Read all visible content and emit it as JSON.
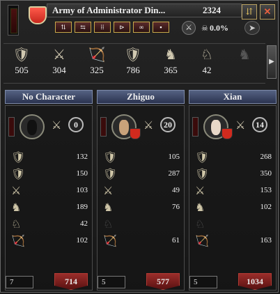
{
  "header": {
    "title": "Army of Administrator Din...",
    "count": "2324",
    "morale_pct": "0.0%",
    "accent": "#c7281e"
  },
  "totals": [
    {
      "icon": "archer-icon",
      "value": "505"
    },
    {
      "icon": "light-cavalry-icon",
      "value": "304"
    },
    {
      "icon": "pikemen-icon",
      "value": "325"
    },
    {
      "icon": "heavy-infantry-icon",
      "value": "786"
    },
    {
      "icon": "horse-archer-icon",
      "value": "365"
    },
    {
      "icon": "knight-icon",
      "value": "42"
    },
    {
      "icon": "camel-icon",
      "value": ""
    }
  ],
  "columns": [
    {
      "name": "No Character",
      "skill": "0",
      "flank_count": "7",
      "total": "714",
      "has_leader": false,
      "units": [
        "132",
        "150",
        "103",
        "189",
        "42",
        "102"
      ]
    },
    {
      "name": "Zhiguo",
      "skill": "20",
      "flank_count": "5",
      "total": "577",
      "has_leader": true,
      "units": [
        "105",
        "287",
        "49",
        "76",
        "",
        "61"
      ]
    },
    {
      "name": "Xian",
      "skill": "14",
      "flank_count": "5",
      "total": "1034",
      "has_leader": true,
      "units": [
        "268",
        "350",
        "153",
        "102",
        "",
        "163"
      ]
    }
  ]
}
